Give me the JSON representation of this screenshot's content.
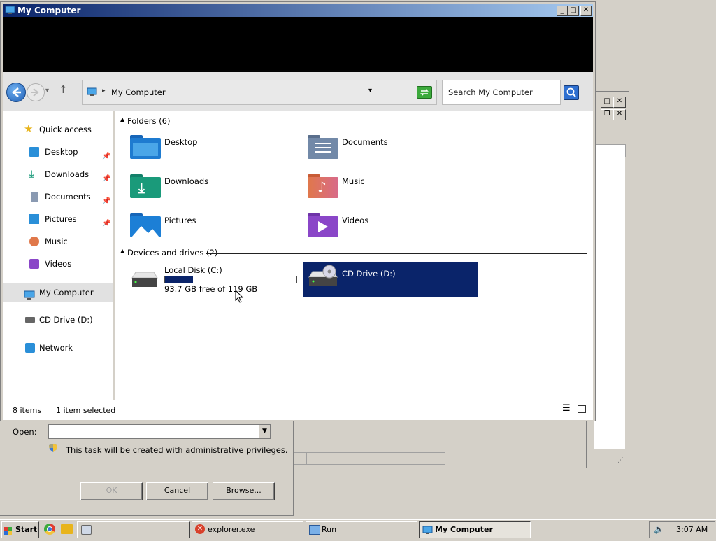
{
  "main_window": {
    "title": "My Computer",
    "minimize": "_",
    "maximize": "□",
    "close": "✕"
  },
  "address_bar": {
    "path": "My Computer",
    "dropdown": "▾",
    "nav_chevron": "▾",
    "up_arrow": "↑"
  },
  "search": {
    "placeholder": "Search My Computer"
  },
  "nav_pane": {
    "items": [
      {
        "label": "Quick access",
        "icon": "star-icon"
      },
      {
        "label": "Desktop",
        "icon": "desktop-icon",
        "pinned": true
      },
      {
        "label": "Downloads",
        "icon": "downloads-icon",
        "pinned": true
      },
      {
        "label": "Documents",
        "icon": "documents-icon",
        "pinned": true
      },
      {
        "label": "Pictures",
        "icon": "pictures-icon",
        "pinned": true
      },
      {
        "label": "Music",
        "icon": "music-icon"
      },
      {
        "label": "Videos",
        "icon": "videos-icon"
      },
      {
        "label": "My Computer",
        "icon": "computer-icon",
        "selected": true
      },
      {
        "label": "CD Drive (D:)",
        "icon": "cd-drive-icon"
      },
      {
        "label": "Network",
        "icon": "network-icon"
      }
    ]
  },
  "content": {
    "folders_header": "Folders (6)",
    "folders": [
      {
        "label": "Desktop",
        "color": "#1e7bd0"
      },
      {
        "label": "Documents",
        "color": "#7289a8"
      },
      {
        "label": "Downloads",
        "color": "#1a9a7a"
      },
      {
        "label": "Music",
        "color": "#e0784a"
      },
      {
        "label": "Pictures",
        "color": "#1c7fd6"
      },
      {
        "label": "Videos",
        "color": "#8a46c8"
      }
    ],
    "drives_header": "Devices and drives (2)",
    "drives": [
      {
        "label": "Local Disk (C:)",
        "free_text": "93.7 GB free of 119 GB",
        "used_fraction": 0.213
      },
      {
        "label": "CD Drive (D:)",
        "selected": true
      }
    ]
  },
  "status_bar": {
    "item_count": "8 items",
    "selection": "1 item selected"
  },
  "run_dialog": {
    "open_label": "Open:",
    "admin_note": "This task will be created with administrative privileges.",
    "ok": "OK",
    "cancel": "Cancel",
    "browse": "Browse..."
  },
  "taskbar": {
    "start": "Start",
    "tasks": [
      "explorer.exe",
      "Run",
      "My Computer"
    ],
    "clock": "3:07 AM"
  },
  "colors": {
    "selection": "#0a246a",
    "title_gradient_start": "#0a246a",
    "title_gradient_end": "#a6caf0",
    "progress_fill": "#0a246a"
  }
}
